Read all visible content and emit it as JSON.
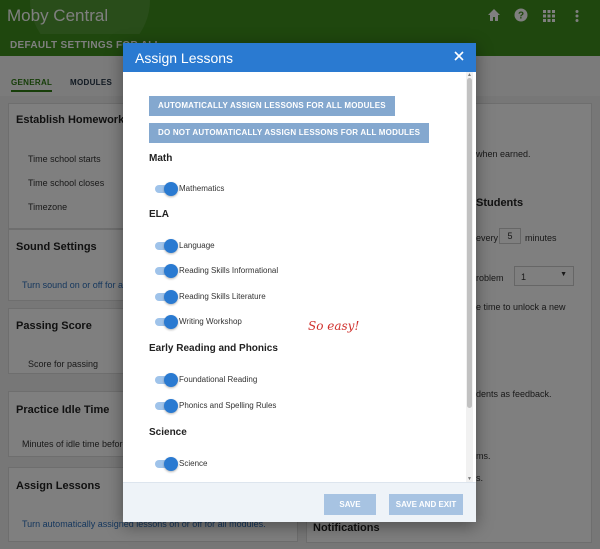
{
  "app": {
    "title": "Moby Central",
    "icons": [
      "home-icon",
      "help-icon",
      "apps-grid-icon",
      "more-vert-icon"
    ]
  },
  "subbar": {
    "title": "DEFAULT SETTINGS FOR ALL..."
  },
  "tabs": [
    {
      "label": "GENERAL",
      "active": true
    },
    {
      "label": "MODULES",
      "active": false
    }
  ],
  "background": {
    "homework": {
      "title": "Establish Homework T...",
      "start": "Time school starts",
      "close": "Time school closes",
      "timezone": "Timezone"
    },
    "sound": {
      "title": "Sound Settings",
      "link": "Turn sound on or off for al..."
    },
    "passing": {
      "title": "Passing Score",
      "label": "Score for passing"
    },
    "idle": {
      "title": "Practice Idle Time",
      "label": "Minutes of idle time before..."
    },
    "assign": {
      "title": "Assign Lessons",
      "link": "Turn automatically assigned lessons on or off for all modules."
    },
    "right": {
      "earned": "when earned.",
      "students_title": "Students",
      "every": "every",
      "every_value": "5",
      "minutes": "minutes",
      "problem": "roblem",
      "problem_value": "1",
      "unlock": "e time to unlock a new",
      "feedback": "dents as feedback.",
      "ms": "ms.",
      "s": "s.",
      "notifications": "Notifications"
    }
  },
  "modal": {
    "title": "Assign Lessons",
    "close_icon": "close-icon",
    "buttons": {
      "auto_assign": "AUTOMATICALLY ASSIGN LESSONS FOR ALL MODULES",
      "no_auto_assign": "DO NOT AUTOMATICALLY ASSIGN LESSONS FOR ALL MODULES"
    },
    "groups": [
      {
        "title": "Math",
        "items": [
          {
            "label": "Mathematics",
            "on": true
          }
        ]
      },
      {
        "title": "ELA",
        "items": [
          {
            "label": "Language",
            "on": true
          },
          {
            "label": "Reading Skills Informational",
            "on": true
          },
          {
            "label": "Reading Skills Literature",
            "on": true
          },
          {
            "label": "Writing Workshop",
            "on": true
          }
        ]
      },
      {
        "title": "Early Reading and Phonics",
        "items": [
          {
            "label": "Foundational Reading",
            "on": true
          },
          {
            "label": "Phonics and Spelling Rules",
            "on": true
          }
        ]
      },
      {
        "title": "Science",
        "items": [
          {
            "label": "Science",
            "on": true
          }
        ]
      }
    ],
    "annotation": "So easy!",
    "footer": {
      "save": "SAVE",
      "save_exit": "SAVE AND EXIT"
    }
  },
  "colors": {
    "brand_green": "#3f8f1d",
    "modal_blue": "#2a7ad1",
    "toggle_on": "#2a7ad1",
    "annotation_red": "#d0312d"
  }
}
